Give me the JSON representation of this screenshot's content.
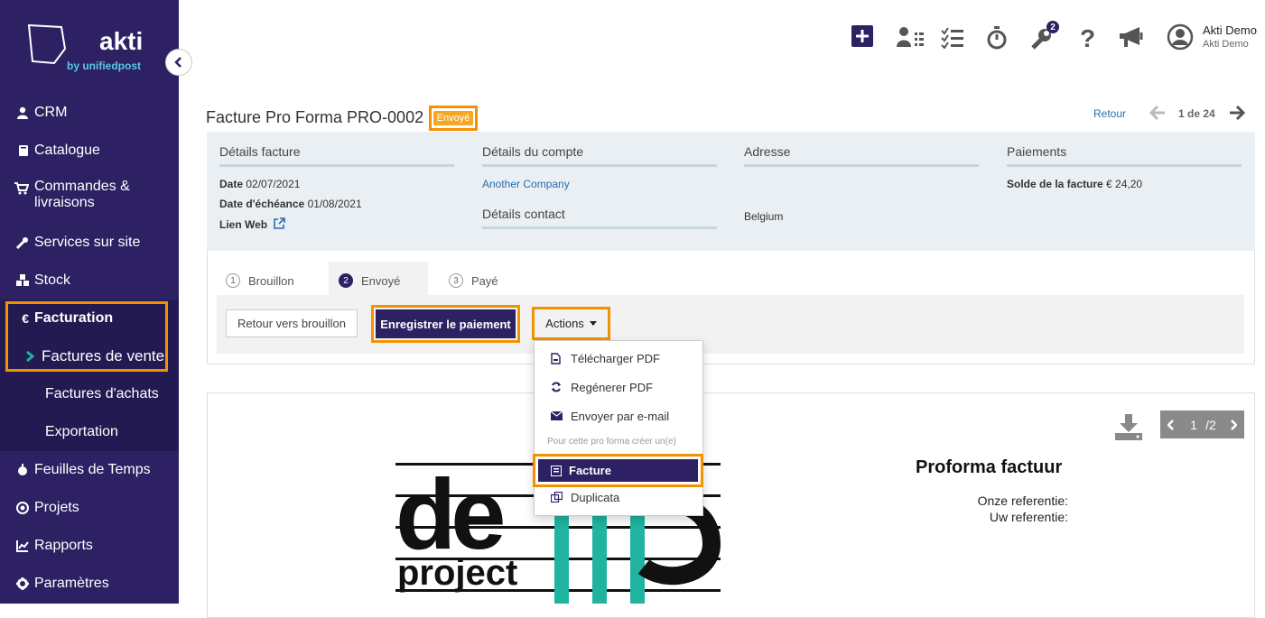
{
  "colors": {
    "brand": "#2d2163",
    "highlight": "#f39200",
    "link": "#2a6db0",
    "accent_teal": "#1fb3a0"
  },
  "sidebar": {
    "logo_text": "akti",
    "logo_sub": "by unifiedpost",
    "items": [
      {
        "label": "CRM",
        "icon": "user-icon"
      },
      {
        "label": "Catalogue",
        "icon": "book-icon"
      },
      {
        "label": "Commandes &",
        "label2": "livraisons",
        "icon": "cart-icon"
      },
      {
        "label": "Services sur site",
        "icon": "wrench-icon"
      },
      {
        "label": "Stock",
        "icon": "cubes-icon"
      },
      {
        "label": "Facturation",
        "icon": "euro-icon"
      },
      {
        "label": "Factures de vente",
        "icon": "chevron-right-icon"
      },
      {
        "label": "Factures d'achats"
      },
      {
        "label": "Exportation"
      },
      {
        "label": "Feuilles de Temps",
        "icon": "stopwatch-icon"
      },
      {
        "label": "Projets",
        "icon": "target-icon"
      },
      {
        "label": "Rapports",
        "icon": "chart-icon"
      },
      {
        "label": "Paramètres",
        "icon": "gear-icon"
      }
    ]
  },
  "topbar": {
    "badge_count": "2",
    "user_name": "Akti Demo",
    "user_company": "Akti Demo"
  },
  "header": {
    "title": "Facture Pro Forma PRO-0002",
    "status": "Envoyé",
    "back": "Retour",
    "pager": "1 de 24"
  },
  "details": {
    "facture": {
      "heading": "Détails facture",
      "date_label": "Date",
      "date": "02/07/2021",
      "due_label": "Date d'échéance",
      "due": "01/08/2021",
      "web_label": "Lien Web"
    },
    "compte": {
      "heading": "Détails du compte",
      "company": "Another Company",
      "contact_heading": "Détails contact"
    },
    "adresse": {
      "heading": "Adresse",
      "country": "Belgium"
    },
    "paiements": {
      "heading": "Paiements",
      "solde_label": "Solde de la facture",
      "solde": "€ 24,20"
    }
  },
  "steps": [
    {
      "num": "1",
      "label": "Brouillon"
    },
    {
      "num": "2",
      "label": "Envoyé"
    },
    {
      "num": "3",
      "label": "Payé"
    }
  ],
  "actions": {
    "back_draft": "Retour vers brouillon",
    "register_payment": "Enregistrer le paiement",
    "actions": "Actions",
    "menu": {
      "download": "Télécharger PDF",
      "regen": "Regénerer PDF",
      "email": "Envoyer par e-mail",
      "section": "Pour cette pro forma créer un(e)",
      "facture": "Facture",
      "duplicata": "Duplicata"
    }
  },
  "preview": {
    "page": "1",
    "total": "/2",
    "doc_title": "Proforma factuur",
    "ref1": "Onze referentie:",
    "ref2": "Uw referentie:",
    "logo_word1": "de",
    "logo_word2": "project"
  }
}
